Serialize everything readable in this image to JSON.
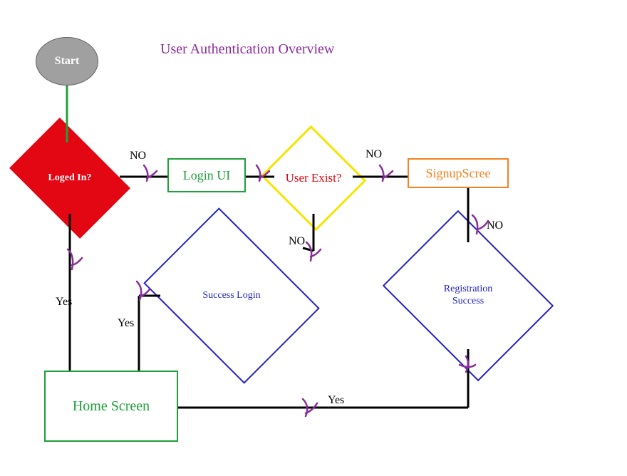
{
  "title": "User Authentication Overview",
  "nodes": {
    "start": "Start",
    "logged_in": "Loged In?",
    "login_ui": "Login UI",
    "user_exist": "User Exist?",
    "signup_screen": "SignupScree",
    "success_login": "Success Login",
    "registration_success": "Registration\nSuccess",
    "home_screen": "Home Screen"
  },
  "edge_labels": {
    "logged_in_yes": "Yes",
    "logged_in_no": "NO",
    "user_exist_no_right": "NO",
    "user_exist_no_down": "NO",
    "signup_no": "NO",
    "success_login_yes": "Yes",
    "registration_success_yes": "Yes"
  },
  "colors": {
    "title": "#8b2c9c",
    "start_fill": "#a0a0a0",
    "red": "#e30613",
    "green": "#1fa03a",
    "yellow": "#f7e400",
    "orange": "#f58220",
    "blue": "#2424c3",
    "black": "#000000",
    "purple_scribble": "#8b2c9c"
  }
}
